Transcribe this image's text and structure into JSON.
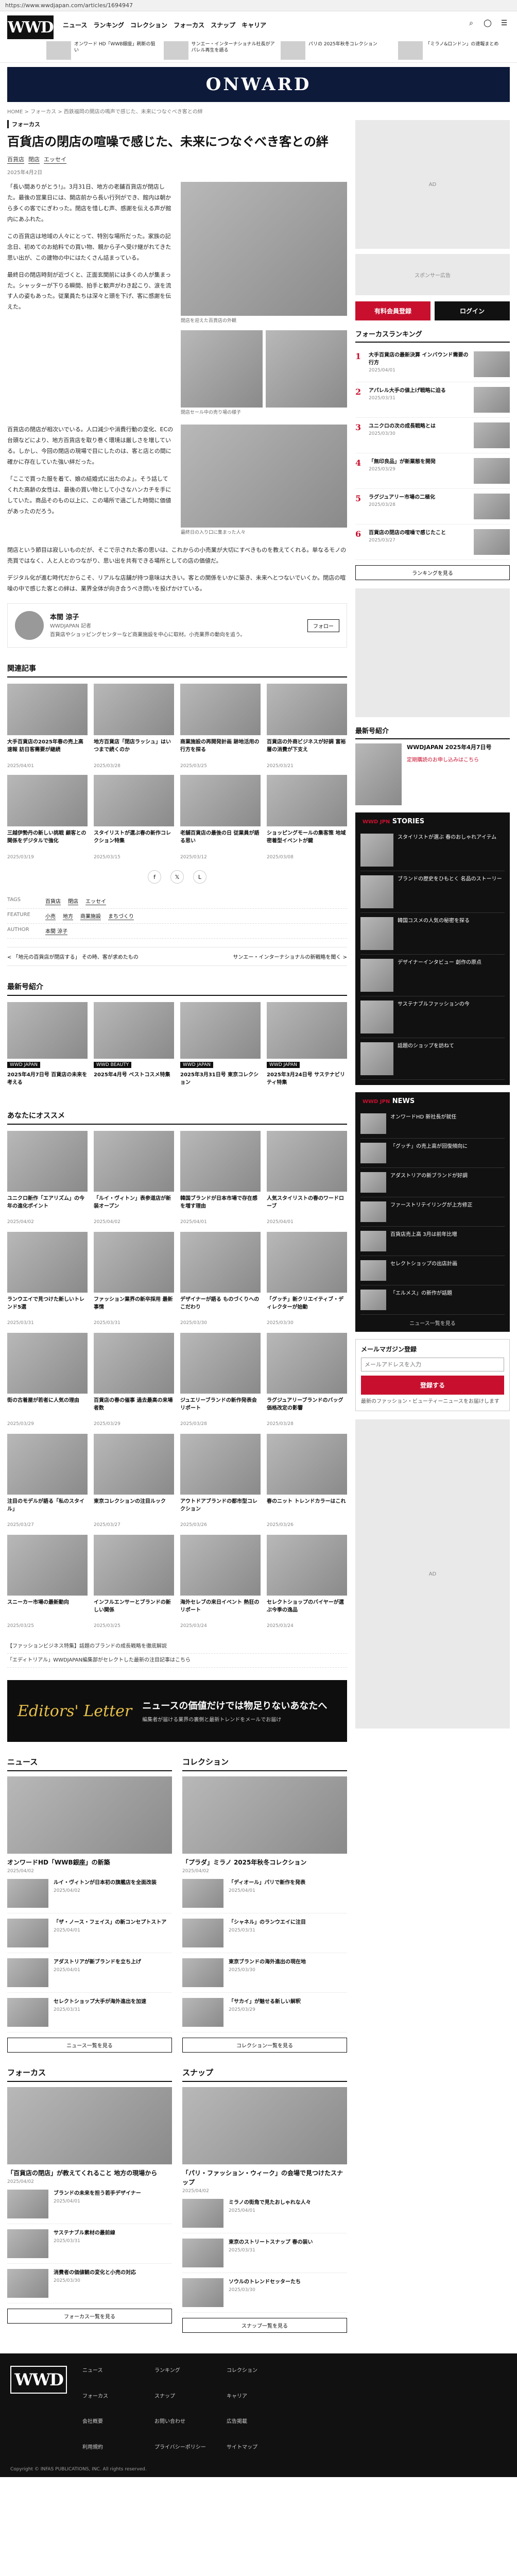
{
  "browser": {
    "url": "https://www.wwdjapan.com/articles/1694947"
  },
  "header": {
    "logo": "WWD",
    "nav": [
      "ニュース",
      "ランキング",
      "コレクション",
      "フォーカス",
      "スナップ",
      "キャリア"
    ],
    "tickers": [
      "オンワード HD「WWB銀座」刷新の狙い",
      "サンエー・インターナショナル社長がアパレル再生を語る",
      "パリの 2025年秋冬コレクション",
      "「ミラノ&ロンドン」の速報まとめ"
    ]
  },
  "banner": {
    "text": "ONWARD"
  },
  "breadcrumb": "HOME > フォーカス > 西鉄福岡の開店の鳴声で感じた、未来につなぐべき客との絆",
  "article": {
    "category": "フォーカス",
    "title": "百貨店の閉店の喧噪で感じた、未来につなぐべき客との絆",
    "tags": [
      "百貨店",
      "閉店",
      "エッセイ"
    ],
    "date": "2025年4月2日",
    "p1": "「長い間ありがとう!」。3月31日、地方の老舗百貨店が閉店した。最後の営業日には、開店前から長い行列ができ、館内は朝から多くの客でにぎわった。閉店を惜しむ声、感謝を伝える声が館内にあふれた。",
    "p2": "この百貨店は地域の人々にとって、特別な場所だった。家族の記念日、初めてのお給料での買い物、親から子へ受け継がれてきた思い出が、この建物の中にはたくさん詰まっている。",
    "p3": "最終日の閉店時刻が近づくと、正面玄関前には多くの人が集まった。シャッターが下りる瞬間、拍手と歓声がわき起こり、涙を流す人の姿もあった。従業員たちは深々と頭を下げ、客に感謝を伝えた。",
    "caption1": "閉店を迎えた百貨店の外観",
    "caption2": "閉店セール中の売り場の様子",
    "caption3": "最終日の入り口に集まった人々",
    "p4": "百貨店の閉店が相次いでいる。人口減少や消費行動の変化、ECの台頭などにより、地方百貨店を取り巻く環境は厳しさを増している。しかし、今回の閉店の現場で目にしたのは、客と店との間に確かに存在していた強い絆だった。",
    "p5": "「ここで買った服を着て、娘の結婚式に出たのよ」。そう話してくれた高齢の女性は、最後の買い物として小さなハンカチを手にしていた。商品そのもの以上に、この場所で過ごした時間に価値があったのだろう。",
    "p6": "閉店という節目は寂しいものだが、そこで示された客の思いは、これからの小売業が大切にすべきものを教えてくれる。単なるモノの売買ではなく、人と人とのつながり、思い出を共有できる場所としての店の価値だ。",
    "p7": "デジタル化が進む時代だからこそ、リアルな店舗が持つ意味は大きい。客との関係をいかに築き、未来へとつないでいくか。閉店の喧噪の中で感じた客との絆は、業界全体が向き合うべき問いを投げかけている。"
  },
  "author": {
    "name": "本間 涼子",
    "role": "WWDJAPAN 記者",
    "bio": "百貨店やショッピングセンターなど商業施設を中心に取材。小売業界の動向を追う。",
    "follow": "フォロー"
  },
  "related": {
    "heading": "関連記事",
    "items": [
      {
        "title": "大手百貨店の2025年春の売上高速報 訪日客需要が継続",
        "meta": "2025/04/01"
      },
      {
        "title": "地方百貨店「閉店ラッシュ」はいつまで続くのか",
        "meta": "2025/03/28"
      },
      {
        "title": "商業施設の再開発計画 跡地活用の行方を探る",
        "meta": "2025/03/25"
      },
      {
        "title": "百貨店の外商ビジネスが好調 富裕層の消費が下支え",
        "meta": "2025/03/21"
      },
      {
        "title": "三越伊勢丹の新しい挑戦 顧客との関係をデジタルで強化",
        "meta": "2025/03/19"
      },
      {
        "title": "スタイリストが選ぶ春の新作コレクション特集",
        "meta": "2025/03/15"
      },
      {
        "title": "老舗百貨店の最後の日 従業員が語る思い",
        "meta": "2025/03/12"
      },
      {
        "title": "ショッピングモールの集客策 地域密着型イベントが鍵",
        "meta": "2025/03/08"
      }
    ]
  },
  "tag_rows": [
    {
      "label": "TAGS",
      "values": [
        "百貨店",
        "閉店",
        "エッセイ"
      ]
    },
    {
      "label": "FEATURE",
      "values": [
        "小売",
        "地方",
        "商業施設",
        "まちづくり"
      ]
    },
    {
      "label": "AUTHOR",
      "values": [
        "本間 涼子"
      ]
    }
  ],
  "prev_next": {
    "prev": "< 「地元の百貨店が閉店する」 その時、客が求めたもの",
    "next": "サンエー・インターナショナルの新戦略を聞く >"
  },
  "recent_mags": {
    "heading": "最新号紹介",
    "items": [
      {
        "label": "WWD JAPAN",
        "title": "2025年4月7日号 百貨店の未来を考える"
      },
      {
        "label": "WWD BEAUTY",
        "title": "2025年4月号 ベストコスメ特集"
      },
      {
        "label": "WWD JAPAN",
        "title": "2025年3月31日号 東京コレクション"
      },
      {
        "label": "WWD JAPAN",
        "title": "2025年3月24日号 サステナビリティ特集"
      }
    ]
  },
  "recommend": {
    "heading": "あなたにオススメ",
    "items": [
      {
        "title": "ユニクロ新作「エアリズム」の今年の進化ポイント",
        "meta": "2025/04/02"
      },
      {
        "title": "「ルイ・ヴィトン」表参道店が新装オープン",
        "meta": "2025/04/02"
      },
      {
        "title": "韓国ブランドが日本市場で存在感を増す理由",
        "meta": "2025/04/01"
      },
      {
        "title": "人気スタイリストの春のワードローブ",
        "meta": "2025/04/01"
      },
      {
        "title": "ランウエイで見つけた新しいトレンド5選",
        "meta": "2025/03/31"
      },
      {
        "title": "ファッション業界の新卒採用 最新事情",
        "meta": "2025/03/31"
      },
      {
        "title": "デザイナーが語る ものづくりへのこだわり",
        "meta": "2025/03/30"
      },
      {
        "title": "「グッチ」新クリエイティブ・ディレクターが始動",
        "meta": "2025/03/30"
      },
      {
        "title": "街の古着屋が若者に人気の理由",
        "meta": "2025/03/29"
      },
      {
        "title": "百貨店の春の催事 過去最高の来場者数",
        "meta": "2025/03/29"
      },
      {
        "title": "ジュエリーブランドの新作発表会リポート",
        "meta": "2025/03/28"
      },
      {
        "title": "ラグジュアリーブランドのバッグ 価格改定の影響",
        "meta": "2025/03/28"
      },
      {
        "title": "注目のモデルが語る「私のスタイル」",
        "meta": "2025/03/27"
      },
      {
        "title": "東京コレクションの注目ルック",
        "meta": "2025/03/27"
      },
      {
        "title": "アウトドアブランドの都市型コレクション",
        "meta": "2025/03/26"
      },
      {
        "title": "春のニット トレンドカラーはこれ",
        "meta": "2025/03/26"
      },
      {
        "title": "スニーカー市場の最新動向",
        "meta": "2025/03/25"
      },
      {
        "title": "インフルエンサーとブランドの新しい関係",
        "meta": "2025/03/25"
      },
      {
        "title": "海外セレブの来日イベント 熱狂のリポート",
        "meta": "2025/03/24"
      },
      {
        "title": "セレクトショップのバイヤーが選ぶ今季の逸品",
        "meta": "2025/03/24"
      }
    ]
  },
  "editorial_notes": [
    "【ファッションビジネス特集】話題のブランドの成長戦略を徹底解説",
    "「エディトリアル」WWDJAPAN編集部がセレクトした最新の注目記事はこちら"
  ],
  "promo": {
    "logo": "Editors' Letter",
    "title": "ニュースの価値だけでは物足りないあなたへ",
    "sub": "編集者が届ける業界の裏側と最新トレンドをメールでお届け"
  },
  "news_col": {
    "heading": "ニュース",
    "lead_title": "オンワードHD「WWB銀座」の新築",
    "lead_meta": "2025/04/02",
    "items": [
      {
        "title": "ルイ・ヴィトンが日本初の旗艦店を全面改装",
        "meta": "2025/04/02"
      },
      {
        "title": "「ザ・ノース・フェイス」の新コンセプトストア",
        "meta": "2025/04/01"
      },
      {
        "title": "アダストリアが新ブランドを立ち上げ",
        "meta": "2025/04/01"
      },
      {
        "title": "セレクトショップ大手が海外進出を加速",
        "meta": "2025/03/31"
      }
    ],
    "more": "ニュース一覧を見る"
  },
  "collection_col": {
    "heading": "コレクション",
    "lead_title": "「プラダ」ミラノ 2025年秋冬コレクション",
    "lead_meta": "2025/04/02",
    "items": [
      {
        "title": "「ディオール」パリで新作を発表",
        "meta": "2025/04/01"
      },
      {
        "title": "「シャネル」のランウエイに注目",
        "meta": "2025/03/31"
      },
      {
        "title": "東京ブランドの海外進出の現在地",
        "meta": "2025/03/30"
      },
      {
        "title": "「サカイ」が魅せる新しい解釈",
        "meta": "2025/03/29"
      }
    ],
    "more": "コレクション一覧を見る"
  },
  "focus_col": {
    "heading": "フォーカス",
    "lead_title": "「百貨店の閉店」が教えてくれること 地方の現場から",
    "lead_meta": "2025/04/02",
    "items": [
      {
        "title": "ブランドの未来を担う若手デザイナー",
        "meta": "2025/04/01"
      },
      {
        "title": "サステナブル素材の最前線",
        "meta": "2025/03/31"
      },
      {
        "title": "消費者の価値観の変化と小売の対応",
        "meta": "2025/03/30"
      }
    ],
    "more": "フォーカス一覧を見る"
  },
  "snap_col": {
    "heading": "スナップ",
    "lead_title": "「パリ・ファッション・ウィーク」の会場で見つけたスナップ",
    "lead_meta": "2025/04/02",
    "items": [
      {
        "title": "ミラノの街角で見たおしゃれな人々",
        "meta": "2025/04/01"
      },
      {
        "title": "東京のストリートスナップ 春の装い",
        "meta": "2025/03/31"
      },
      {
        "title": "ソウルのトレンドセッターたち",
        "meta": "2025/03/30"
      }
    ],
    "more": "スナップ一覧を見る"
  },
  "sidebar": {
    "ad_top": "AD",
    "ad_text": "スポンサー広告",
    "subscribe": "有料会員登録",
    "login": "ログイン",
    "ranking_heading": "フォーカスランキング",
    "ranking": [
      {
        "n": "1",
        "title": "大手百貨店の最新決算 インバウンド需要の行方",
        "meta": "2025/04/01"
      },
      {
        "n": "2",
        "title": "アパレル大手の値上げ戦略に迫る",
        "meta": "2025/03/31"
      },
      {
        "n": "3",
        "title": "ユニクロの次の成長戦略とは",
        "meta": "2025/03/30"
      },
      {
        "n": "4",
        "title": "「無印良品」が新業態を開発",
        "meta": "2025/03/29"
      },
      {
        "n": "5",
        "title": "ラグジュアリー市場の二極化",
        "meta": "2025/03/28"
      },
      {
        "n": "6",
        "title": "百貨店の閉店の喧噪で感じたこと",
        "meta": "2025/03/27"
      }
    ],
    "ranking_more": "ランキングを見る",
    "mag_heading": "最新号紹介",
    "mag_title": "WWDJAPAN 2025年4月7日号",
    "mag_sub": "定期購読のお申し込みはこちら",
    "stories_heading": "STORIES",
    "stories_tag": "WWD JPN",
    "stories": [
      "スタイリストが選ぶ 春のおしゃれアイテム",
      "ブランドの歴史をひもとく 名品のストーリー",
      "韓国コスメの人気の秘密を探る",
      "デザイナーインタビュー 創作の原点",
      "サステナブルファッションの今",
      "話題のショップを訪ねて"
    ],
    "news_heading": "NEWS",
    "news": [
      "オンワードHD 新社長が就任",
      "「グッチ」の売上高が回復傾向に",
      "アダストリアの新ブランドが好調",
      "ファーストリテイリングが上方修正",
      "百貨店売上高 3月は前年比増",
      "セレクトショップの出店計画",
      "「エルメス」の新作が話題"
    ],
    "news_more": "ニュース一覧を見る",
    "newsletter_heading": "メールマガジン登録",
    "newsletter_placeholder": "メールアドレスを入力",
    "newsletter_button": "登録する",
    "newsletter_note": "最新のファッション・ビューティーニュースをお届けします",
    "ad_bottom": "AD"
  },
  "footer": {
    "logo": "WWD",
    "links": [
      "ニュース",
      "ランキング",
      "コレクション",
      "フォーカス",
      "スナップ",
      "キャリア",
      "会社概要",
      "お問い合わせ",
      "広告掲載",
      "利用規約",
      "プライバシーポリシー",
      "サイトマップ"
    ],
    "copyright": "Copyright © INFAS PUBLICATIONS, INC. All rights reserved."
  }
}
